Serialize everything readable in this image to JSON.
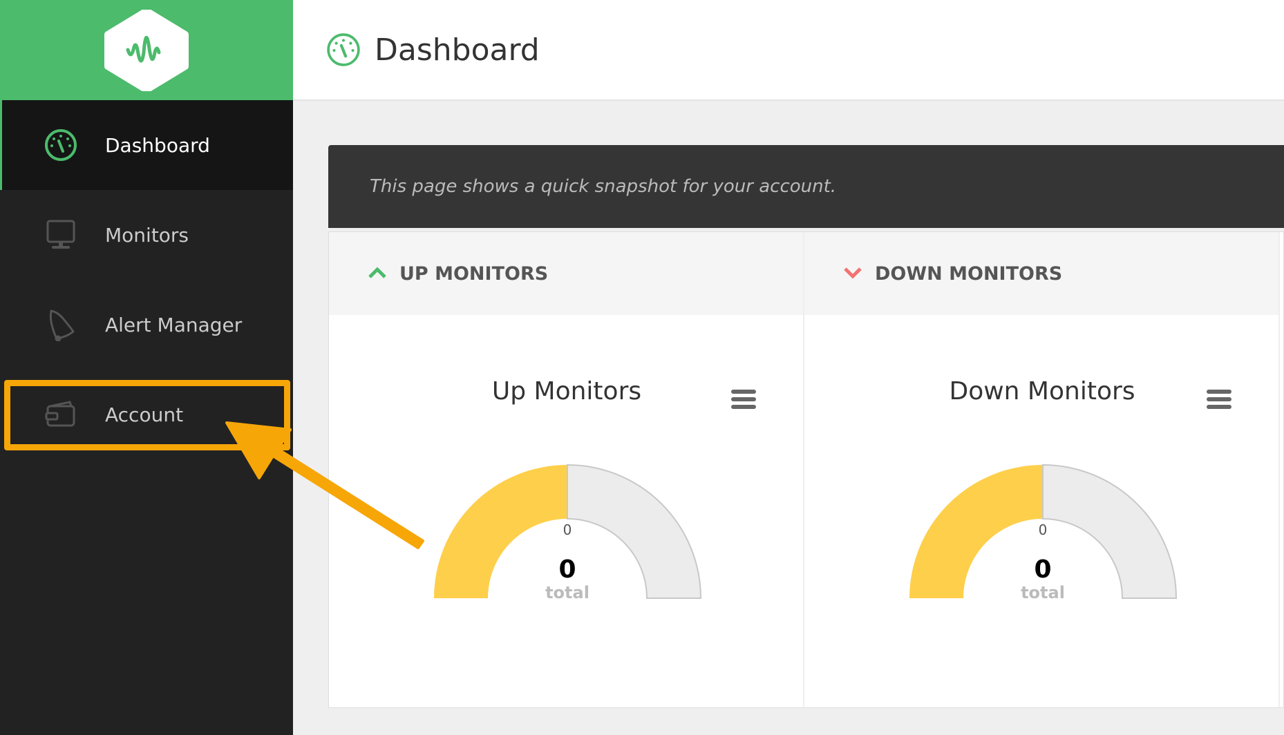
{
  "sidebar": {
    "items": [
      {
        "label": "Dashboard",
        "icon": "dashboard-icon"
      },
      {
        "label": "Monitors",
        "icon": "monitor-icon"
      },
      {
        "label": "Alert Manager",
        "icon": "bell-icon"
      },
      {
        "label": "Account",
        "icon": "wallet-icon"
      }
    ]
  },
  "header": {
    "title": "Dashboard"
  },
  "banner": {
    "text": "This page shows a quick snapshot for your account."
  },
  "panels": [
    {
      "heading": "UP MONITORS",
      "chart_title": "Up Monitors",
      "value": "0",
      "tick": "0",
      "unit": "total",
      "filled_fraction": 0.5
    },
    {
      "heading": "DOWN MONITORS",
      "chart_title": "Down Monitors",
      "value": "0",
      "tick": "0",
      "unit": "total",
      "filled_fraction": 0.5
    }
  ],
  "colors": {
    "brand": "#4cbb6c",
    "up": "#4cbb6c",
    "down": "#f27272",
    "gauge_fill": "#fecf4a",
    "gauge_empty": "#ececec",
    "highlight": "#f7a608"
  }
}
